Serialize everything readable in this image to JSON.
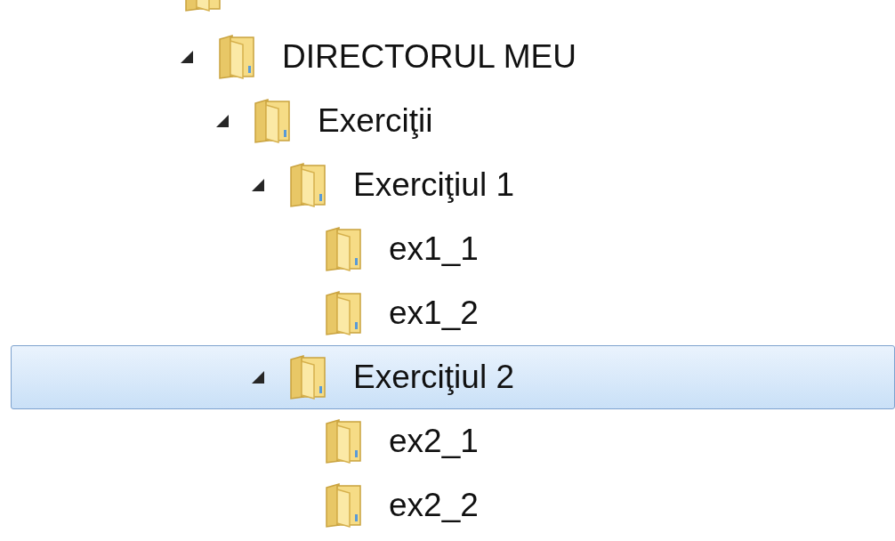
{
  "tree": [
    {
      "label": "DIRECTORUL MEU",
      "expanded": true,
      "selected": false,
      "children": [
        {
          "label": "Exerciţii",
          "expanded": true,
          "selected": false,
          "children": [
            {
              "label": "Exerciţiul 1",
              "expanded": true,
              "selected": false,
              "children": [
                {
                  "label": "ex1_1",
                  "selected": false
                },
                {
                  "label": "ex1_2",
                  "selected": false
                }
              ]
            },
            {
              "label": "Exerciţiul 2",
              "expanded": true,
              "selected": true,
              "children": [
                {
                  "label": "ex2_1",
                  "selected": false
                },
                {
                  "label": "ex2_2",
                  "selected": false
                }
              ]
            }
          ]
        }
      ]
    }
  ]
}
